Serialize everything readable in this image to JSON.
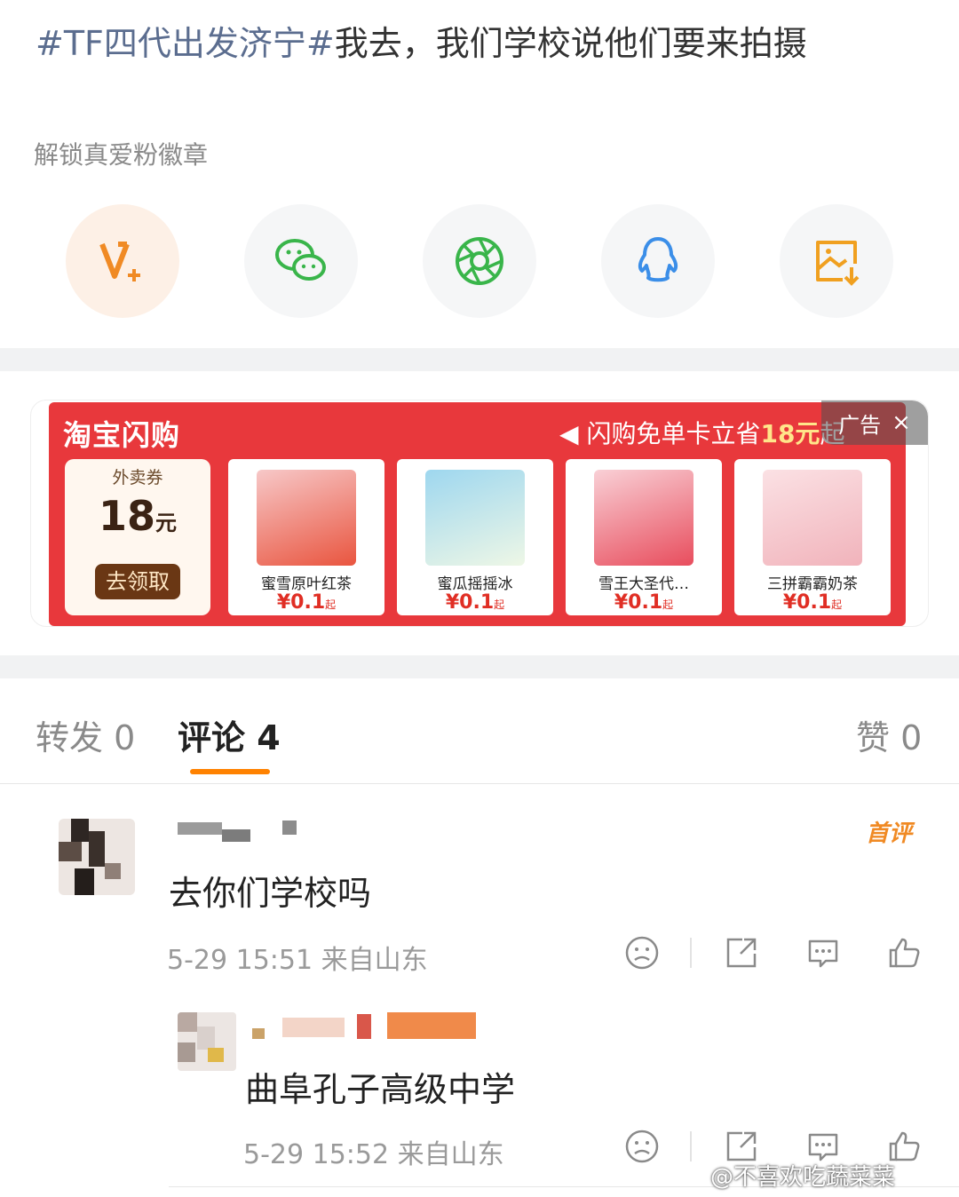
{
  "post": {
    "topic": "#TF四代出发济宁#",
    "text": "我去，我们学校说他们要来拍摄"
  },
  "unlock_label": "解锁真爱粉徽章",
  "share": {
    "icons": [
      "vip-plus-icon",
      "wechat-icon",
      "moments-icon",
      "qq-icon",
      "save-image-icon"
    ],
    "colors": {
      "vip": "#f08a24",
      "wechat": "#39b54a",
      "moments": "#39b54a",
      "qq": "#3b8ee8",
      "save": "#f0a020"
    }
  },
  "ad": {
    "brand": "淘宝闪购",
    "promo_prefix": "闪购免单卡立省",
    "promo_highlight": "18元",
    "promo_suffix": "起",
    "ad_label": "广告",
    "close": "×",
    "coupon": {
      "tag": "外卖券",
      "amount": "18",
      "unit": "元",
      "button": "去领取"
    },
    "products": [
      {
        "name": "蜜雪原叶红茶",
        "price": "¥0.1",
        "suffix": "起"
      },
      {
        "name": "蜜瓜摇摇冰",
        "price": "¥0.1",
        "suffix": "起"
      },
      {
        "name": "雪王大圣代…",
        "price": "¥0.1",
        "suffix": "起"
      },
      {
        "name": "三拼霸霸奶茶",
        "price": "¥0.1",
        "suffix": "起"
      }
    ],
    "colors": {
      "bg": "#e8383c"
    }
  },
  "tabs": {
    "repost": "转发 0",
    "comments": "评论 4",
    "likes": "赞 0",
    "accent": "#ff8200"
  },
  "comments": [
    {
      "text": "去你们学校吗",
      "meta": "5-29 15:51 来自山东",
      "badge": "首评"
    },
    {
      "text": "曲阜孔子高级中学",
      "meta": "5-29 15:52 来自山东"
    }
  ],
  "watermark": "@不喜欢吃蔬菜菜"
}
